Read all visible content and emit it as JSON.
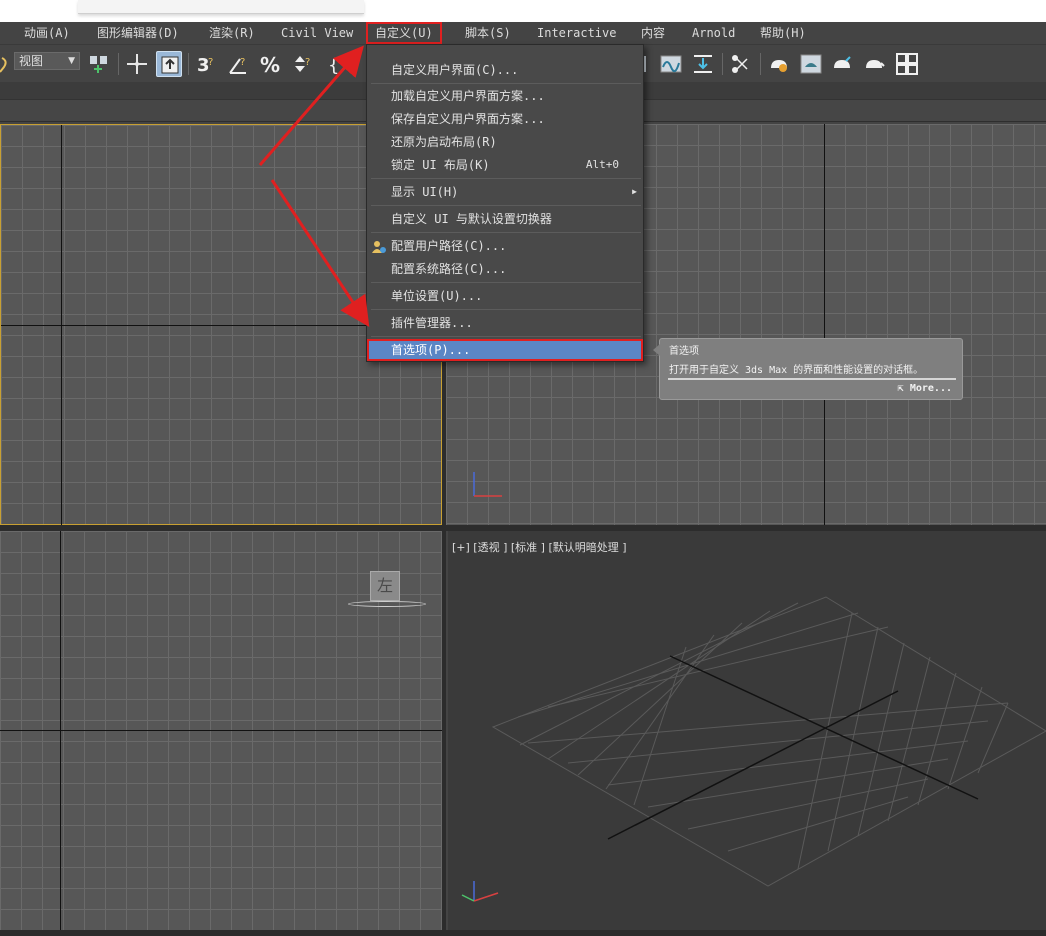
{
  "menubar": {
    "items": [
      {
        "label": "动画(A)"
      },
      {
        "label": "图形编辑器(D)"
      },
      {
        "label": "渲染(R)"
      },
      {
        "label": "Civil View"
      },
      {
        "label": "自定义(U)"
      },
      {
        "label": "脚本(S)"
      },
      {
        "label": "Interactive"
      },
      {
        "label": "内容"
      },
      {
        "label": "Arnold"
      },
      {
        "label": "帮助(H)"
      }
    ]
  },
  "toolbar": {
    "view_select": "视图"
  },
  "customize_menu": {
    "items": [
      {
        "label": "自定义用户界面(C)..."
      },
      {
        "label": "加载自定义用户界面方案..."
      },
      {
        "label": "保存自定义用户界面方案..."
      },
      {
        "label": "还原为启动布局(R)"
      },
      {
        "label": "锁定 UI 布局(K)",
        "shortcut": "Alt+0"
      },
      {
        "label": "显示 UI(H)"
      },
      {
        "label": "自定义 UI 与默认设置切换器"
      },
      {
        "label": "配置用户路径(C)..."
      },
      {
        "label": "配置系统路径(C)..."
      },
      {
        "label": "单位设置(U)..."
      },
      {
        "label": "插件管理器..."
      },
      {
        "label": "首选项(P)..."
      }
    ]
  },
  "tooltip": {
    "title": "首选项",
    "description": "打开用于自定义 3ds Max 的界面和性能设置的对话框。",
    "more": "More..."
  },
  "viewport": {
    "perspective_label": "[+] [透视 ] [标准 ] [默认明暗处理 ]",
    "viewcube_face": "左"
  },
  "colors": {
    "highlight": "#5b86c5",
    "annotation_red": "#e02020",
    "active_viewport_border": "#c8a032"
  }
}
